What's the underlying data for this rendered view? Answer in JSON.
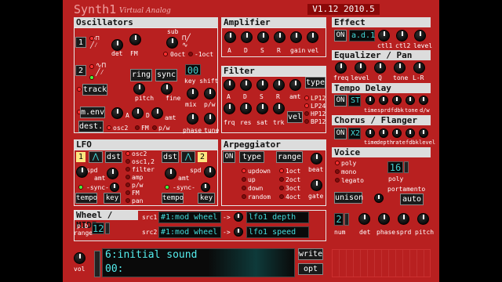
{
  "app": {
    "title": "Synth1",
    "subtitle": "Virtual Analog",
    "version": "V1.12 2010.5"
  },
  "oscillators": {
    "title": "Oscillators",
    "osc1_num": "1",
    "osc2_num": "2",
    "labels": {
      "det": "det",
      "fm": "FM",
      "sub": "sub",
      "oct0": "0oct",
      "oct_minus": "-1oct",
      "ring": "ring",
      "sync": "sync",
      "track": "track",
      "pitch": "pitch",
      "fine": "fine",
      "menv": "m.env",
      "dest": "dest.",
      "a": "A",
      "d": "D",
      "amt": "amt",
      "osc2": "osc2",
      "fm2": "FM",
      "pw": "p/w",
      "mix": "mix",
      "key_shift": "key shift",
      "key_shift_value": "00",
      "phase": "phase",
      "tune": "tune",
      "pw2": "p/w"
    }
  },
  "amplifier": {
    "title": "Amplifier",
    "labels": [
      "A",
      "D",
      "S",
      "R",
      "gain",
      "vel"
    ]
  },
  "filter": {
    "title": "Filter",
    "type_label": "type",
    "knob_labels": [
      "A",
      "D",
      "S",
      "R",
      "amt"
    ],
    "bottom_labels": [
      "frq",
      "res",
      "sat",
      "trk"
    ],
    "vel_label": "vel",
    "types": [
      "LP12",
      "LP24",
      "HP12",
      "BP12"
    ]
  },
  "effect": {
    "title": "Effect",
    "on_label": "ON",
    "type_value": "a.d.1",
    "labels": [
      "ctl1",
      "ctl2",
      "level"
    ]
  },
  "equalizer": {
    "title": "Equalizer / Pan",
    "labels": [
      "freq",
      "level",
      "Q",
      "tone",
      "L-R"
    ]
  },
  "tempo_delay": {
    "title": "Tempo Delay",
    "on_label": "ON",
    "type_value": "ST",
    "labels": [
      "time",
      "sprd",
      "fdbk",
      "tone",
      "d/w"
    ]
  },
  "chorus": {
    "title": "Chorus / Flanger",
    "on_label": "ON",
    "type_value": "X2",
    "labels": [
      "time",
      "depth",
      "rate",
      "fdbk",
      "level"
    ]
  },
  "lfo": {
    "title": "LFO",
    "lfo1_num": "1",
    "lfo2_num": "2",
    "dst_label": "dst",
    "spd": "spd",
    "amt": "amt",
    "sync": "-sync-",
    "tempo": "tempo",
    "key": "key",
    "destinations": [
      "osc2",
      "osc1,2",
      "filter",
      "amp",
      "p/w",
      "FM",
      "pan"
    ]
  },
  "arpeggiator": {
    "title": "Arpeggiator",
    "on_label": "ON",
    "type_label": "type",
    "range_label": "range",
    "beat_label": "beat",
    "gate_label": "gate",
    "modes": [
      "updown",
      "up",
      "down",
      "random"
    ],
    "ranges": [
      "1oct",
      "2oct",
      "3oct",
      "4oct"
    ]
  },
  "voice": {
    "title": "Voice",
    "modes": [
      "poly",
      "mono",
      "legato"
    ],
    "poly_value": "16",
    "poly_label": "poly",
    "unison_label": "unison",
    "portamento_label": "portamento",
    "auto_label": "auto",
    "num_value": "2",
    "num_label": "num",
    "labels": [
      "det",
      "phase",
      "sprd",
      "pitch"
    ]
  },
  "wheel_midi": {
    "title": "Wheel / MIDI",
    "pb_label": "p.b",
    "range_label": "range",
    "range_value": "12",
    "src1_label": "src1",
    "src2_label": "src2",
    "src1_value": "#1:mod wheel",
    "src2_value": "#1:mod wheel",
    "dst1_value": "lfo1 depth",
    "dst2_value": "lfo1 speed",
    "arrow": "->"
  },
  "bottom": {
    "vol_label": "vol",
    "patch_name": "6:initial sound",
    "patch_sub": "00:",
    "write_label": "write",
    "opt_label": "opt"
  }
}
